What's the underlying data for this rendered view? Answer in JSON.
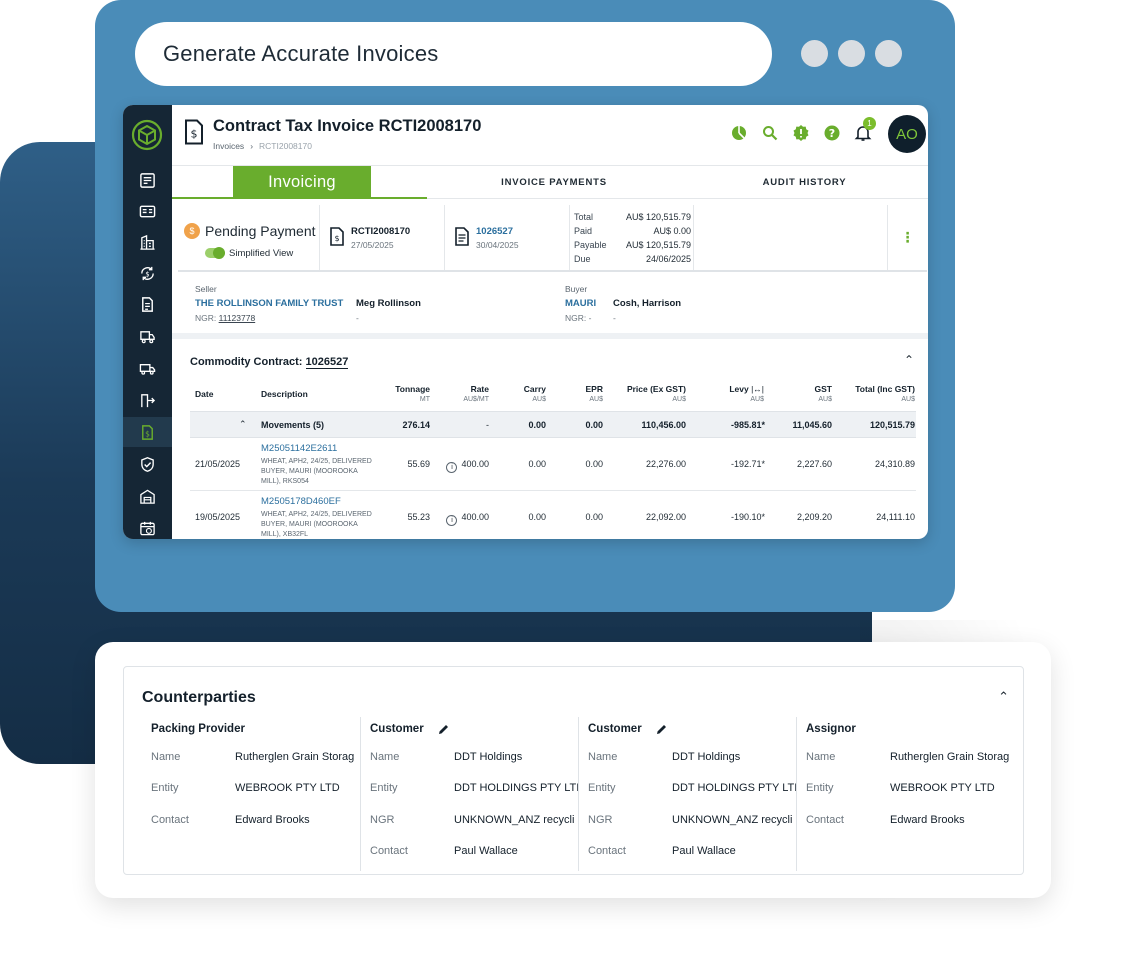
{
  "tagline": "Generate Accurate Invoices",
  "header": {
    "title": "Contract Tax Invoice RCTI2008170",
    "breadcrumb": [
      "Invoices",
      "RCTI2008170"
    ],
    "notification_count": "1",
    "avatar_initials": "AO"
  },
  "tabs": [
    {
      "label": "Invoicing",
      "active": true
    },
    {
      "label": "INVOICE PAYMENTS",
      "active": false
    },
    {
      "label": "AUDIT HISTORY",
      "active": false
    }
  ],
  "summary": {
    "status": "Pending Payment",
    "simplified_view_label": "Simplified View",
    "simplified_view_on": true,
    "invoice_ref": "RCTI2008170",
    "invoice_date": "27/05/2025",
    "contract_ref": "1026527",
    "contract_date": "30/04/2025",
    "totals": [
      {
        "label": "Total",
        "value": "AU$ 120,515.79"
      },
      {
        "label": "Paid",
        "value": "AU$ 0.00"
      },
      {
        "label": "Payable",
        "value": "AU$ 120,515.79"
      },
      {
        "label": "Due",
        "value": "24/06/2025"
      }
    ]
  },
  "seller": {
    "label": "Seller",
    "company": "THE ROLLINSON FAMILY TRUST",
    "contact": "Meg Rollinson",
    "ngr_label": "NGR:",
    "ngr": "11123778",
    "contact_sub": "-"
  },
  "buyer": {
    "label": "Buyer",
    "company": "MAURI",
    "contact": "Cosh, Harrison",
    "ngr_label": "NGR:",
    "ngr": "-",
    "contact_sub": "-"
  },
  "commodity": {
    "title": "Commodity Contract:",
    "contract_no": "1026527",
    "columns": [
      {
        "label": "Date",
        "unit": ""
      },
      {
        "label": "Description",
        "unit": ""
      },
      {
        "label": "Tonnage",
        "unit": "MT"
      },
      {
        "label": "Rate",
        "unit": "AU$/MT"
      },
      {
        "label": "Carry",
        "unit": "AU$"
      },
      {
        "label": "EPR",
        "unit": "AU$"
      },
      {
        "label": "Price (Ex GST)",
        "unit": "AU$"
      },
      {
        "label": "Levy",
        "unit": "AU$"
      },
      {
        "label": "GST",
        "unit": "AU$"
      },
      {
        "label": "Total (Inc GST)",
        "unit": "AU$"
      }
    ],
    "movements": {
      "label": "Movements (5)",
      "tonnage": "276.14",
      "rate": "-",
      "carry": "0.00",
      "epr": "0.00",
      "price": "110,456.00",
      "levy": "-985.81*",
      "gst": "11,045.60",
      "total": "120,515.79"
    },
    "rows": [
      {
        "date": "21/05/2025",
        "id": "M25051142E2611",
        "desc": "WHEAT, APH2, 24/25, DELIVERED BUYER, MAURI (MOOROOKA MILL), RKS054",
        "tonnage": "55.69",
        "rate": "400.00",
        "carry": "0.00",
        "epr": "0.00",
        "price": "22,276.00",
        "levy": "-192.71*",
        "gst": "2,227.60",
        "total": "24,310.89"
      },
      {
        "date": "19/05/2025",
        "id": "M2505178D460EF",
        "desc": "WHEAT, APH2, 24/25, DELIVERED BUYER, MAURI (MOOROOKA MILL), XB32FL",
        "tonnage": "55.23",
        "rate": "400.00",
        "carry": "0.00",
        "epr": "0.00",
        "price": "22,092.00",
        "levy": "-190.10*",
        "gst": "2,209.20",
        "total": "24,111.10"
      }
    ]
  },
  "counterparties": {
    "title": "Counterparties",
    "columns": [
      {
        "heading": "Packing Provider",
        "editable": false,
        "fields": [
          {
            "k": "Name",
            "v": "Rutherglen Grain Storag"
          },
          {
            "k": "Entity",
            "v": "WEBROOK PTY LTD"
          },
          {
            "k": "Contact",
            "v": "Edward Brooks"
          }
        ]
      },
      {
        "heading": "Customer",
        "editable": true,
        "fields": [
          {
            "k": "Name",
            "v": "DDT Holdings"
          },
          {
            "k": "Entity",
            "v": "DDT HOLDINGS PTY LTI"
          },
          {
            "k": "NGR",
            "v": "UNKNOWN_ANZ recycli"
          },
          {
            "k": "Contact",
            "v": "Paul Wallace"
          }
        ]
      },
      {
        "heading": "Customer",
        "editable": true,
        "fields": [
          {
            "k": "Name",
            "v": "DDT Holdings"
          },
          {
            "k": "Entity",
            "v": "DDT HOLDINGS PTY LTI"
          },
          {
            "k": "NGR",
            "v": "UNKNOWN_ANZ recycli"
          },
          {
            "k": "Contact",
            "v": "Paul Wallace"
          }
        ]
      },
      {
        "heading": "Assignor",
        "editable": false,
        "fields": [
          {
            "k": "Name",
            "v": "Rutherglen Grain Storag"
          },
          {
            "k": "Entity",
            "v": "WEBROOK PTY LTD"
          },
          {
            "k": "Contact",
            "v": "Edward Brooks"
          }
        ]
      }
    ]
  },
  "colors": {
    "brand_green": "#69ad2d",
    "rail_navy": "#152635",
    "frame_blue": "#4a8cb8",
    "link_blue": "#2b6f9e",
    "status_orange": "#f0a24a"
  },
  "icons": {
    "rail": [
      "logo-icon",
      "checklist-icon",
      "id-card-icon",
      "buildings-icon",
      "exchange-dollar-icon",
      "document-icon",
      "truck-clock-icon",
      "truck-icon",
      "transfer-icon",
      "invoice-dollar-icon",
      "shield-check-icon",
      "warehouse-icon",
      "calendar-clock-icon"
    ],
    "top": [
      "pie-chart-icon",
      "search-icon",
      "alert-badge-icon",
      "help-icon",
      "bell-icon"
    ]
  }
}
